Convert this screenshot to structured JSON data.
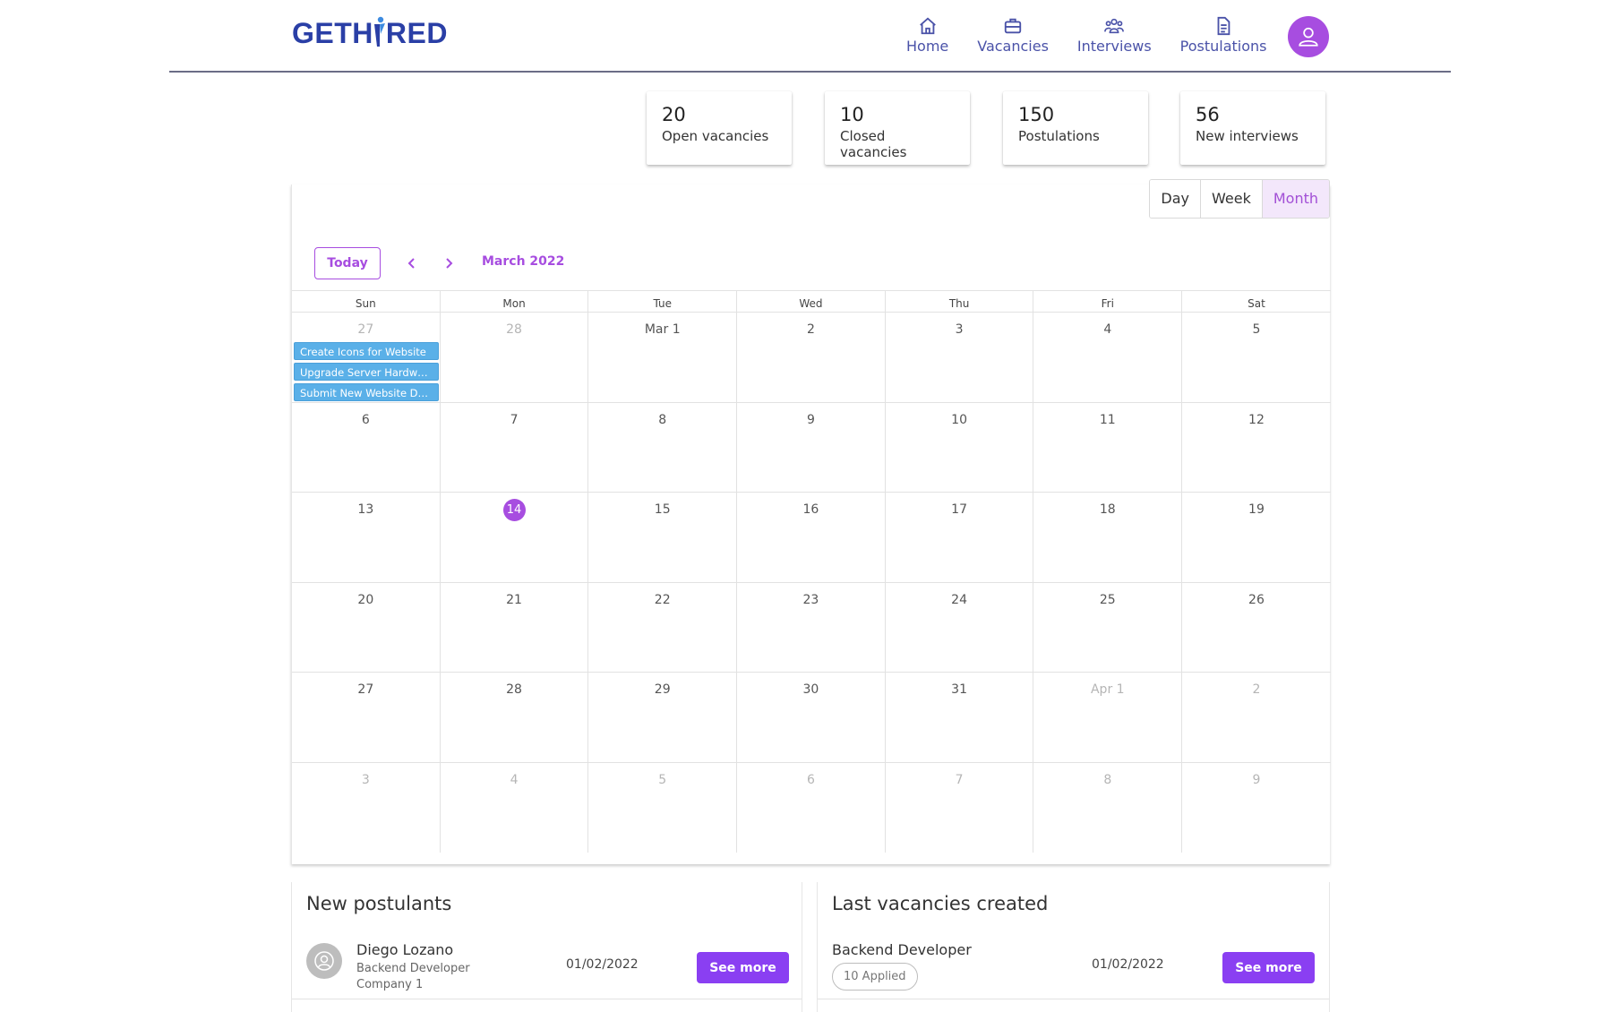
{
  "brand": {
    "logo_left": "GETH",
    "logo_right": "RED",
    "accent": "#a74de0",
    "logo_color": "#2a3fa6"
  },
  "nav": {
    "items": [
      {
        "label": "Home",
        "icon": "home-icon"
      },
      {
        "label": "Vacancies",
        "icon": "briefcase-icon"
      },
      {
        "label": "Interviews",
        "icon": "people-icon"
      },
      {
        "label": "Postulations",
        "icon": "document-icon"
      }
    ],
    "profile_icon": "user-icon"
  },
  "stats": [
    {
      "value": "20",
      "label": "Open vacancies"
    },
    {
      "value": "10",
      "label": "Closed vacancies"
    },
    {
      "value": "150",
      "label": "Postulations"
    },
    {
      "value": "56",
      "label": "New interviews"
    }
  ],
  "calendar": {
    "views": [
      "Day",
      "Week",
      "Month"
    ],
    "active_view": "Month",
    "today_label": "Today",
    "month_label": "March 2022",
    "weekdays": [
      "Sun",
      "Mon",
      "Tue",
      "Wed",
      "Thu",
      "Fri",
      "Sat"
    ],
    "weeks": [
      [
        {
          "d": "27",
          "m": true
        },
        {
          "d": "28",
          "m": true
        },
        {
          "d": "Mar 1"
        },
        {
          "d": "2"
        },
        {
          "d": "3"
        },
        {
          "d": "4"
        },
        {
          "d": "5"
        }
      ],
      [
        {
          "d": "6"
        },
        {
          "d": "7"
        },
        {
          "d": "8"
        },
        {
          "d": "9"
        },
        {
          "d": "10"
        },
        {
          "d": "11"
        },
        {
          "d": "12"
        }
      ],
      [
        {
          "d": "13"
        },
        {
          "d": "14",
          "today": true
        },
        {
          "d": "15"
        },
        {
          "d": "16"
        },
        {
          "d": "17"
        },
        {
          "d": "18"
        },
        {
          "d": "19"
        }
      ],
      [
        {
          "d": "20"
        },
        {
          "d": "21"
        },
        {
          "d": "22"
        },
        {
          "d": "23"
        },
        {
          "d": "24"
        },
        {
          "d": "25"
        },
        {
          "d": "26"
        }
      ],
      [
        {
          "d": "27"
        },
        {
          "d": "28"
        },
        {
          "d": "29"
        },
        {
          "d": "30"
        },
        {
          "d": "31"
        },
        {
          "d": "Apr 1",
          "m": true
        },
        {
          "d": "2",
          "m": true
        }
      ],
      [
        {
          "d": "3",
          "m": true
        },
        {
          "d": "4",
          "m": true
        },
        {
          "d": "5",
          "m": true
        },
        {
          "d": "6",
          "m": true
        },
        {
          "d": "7",
          "m": true
        },
        {
          "d": "8",
          "m": true
        },
        {
          "d": "9",
          "m": true
        }
      ]
    ],
    "events": [
      "Create Icons for Website",
      "Upgrade Server Hardware",
      "Submit New Website Desi..."
    ],
    "event_color": "#5ab0e8"
  },
  "postulants": {
    "title": "New postulants",
    "items": [
      {
        "name": "Diego Lozano",
        "role": "Backend Developer",
        "company": "Company 1",
        "date": "01/02/2022",
        "button": "See more"
      }
    ]
  },
  "vacancies": {
    "title": "Last vacancies created",
    "items": [
      {
        "title": "Backend Developer",
        "applied": "10 Applied",
        "date": "01/02/2022",
        "button": "See more"
      }
    ]
  }
}
